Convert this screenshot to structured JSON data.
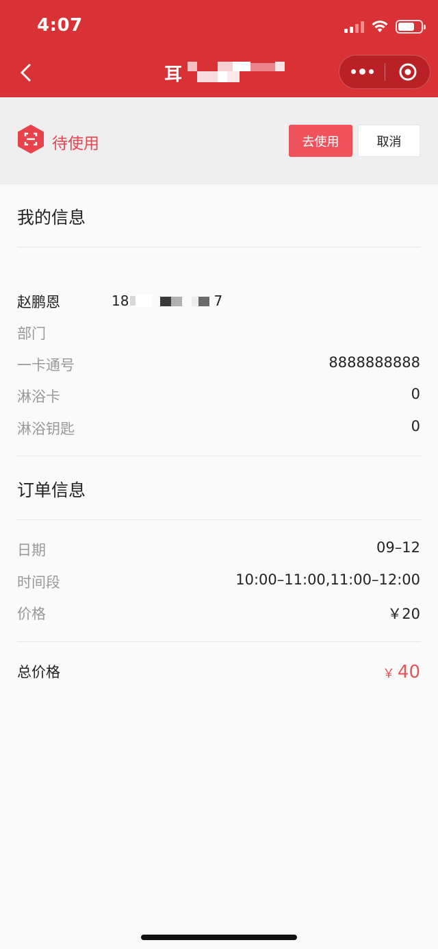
{
  "status_bar": {
    "time": "4:07"
  },
  "nav": {
    "title_visible": "耳",
    "back_icon": "chevron-left-icon",
    "more_icon": "more-dots-icon",
    "close_icon": "target-close-icon"
  },
  "order_status": {
    "icon": "scan-hexagon-icon",
    "label": "待使用",
    "use_button": "去使用",
    "cancel_button": "取消"
  },
  "my_info": {
    "title": "我的信息",
    "name": "赵鹏恩",
    "phone_start": "18",
    "phone_end": "7",
    "rows": [
      {
        "label": "部门",
        "value": ""
      },
      {
        "label": "一卡通号",
        "value": "8888888888"
      },
      {
        "label": "淋浴卡",
        "value": "0"
      },
      {
        "label": "淋浴钥匙",
        "value": "0"
      }
    ]
  },
  "order_info": {
    "title": "订单信息",
    "rows": [
      {
        "label": "日期",
        "value": "09–12"
      },
      {
        "label": "时间段",
        "value": "10:00–11:00,11:00–12:00"
      },
      {
        "label": "价格",
        "value": "￥20"
      }
    ],
    "total_label": "总价格",
    "total_currency": "￥",
    "total_value": "40"
  },
  "colors": {
    "header_red": "#d93236",
    "accent_red": "#f0525b",
    "total_red": "#e6535b"
  }
}
